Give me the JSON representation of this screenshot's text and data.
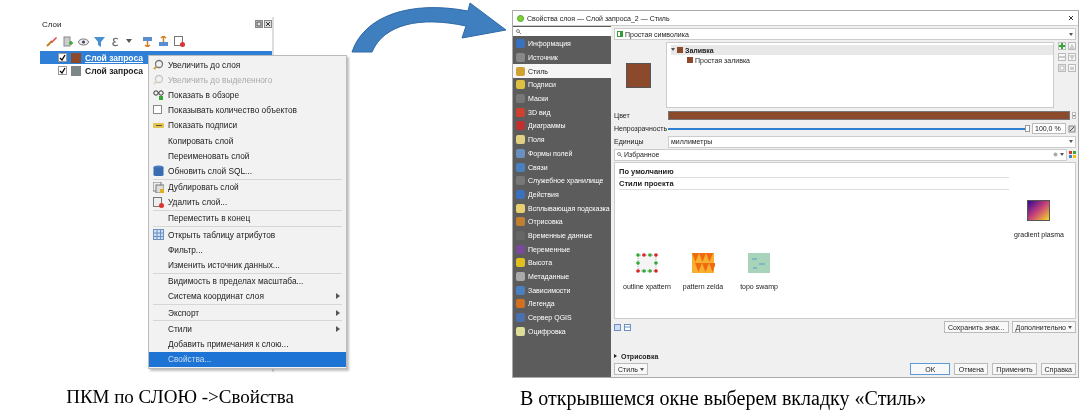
{
  "left": {
    "panel_title": "Слои",
    "layers": [
      {
        "name": "Слой запроса",
        "checked": true,
        "color": "#8b4a2b",
        "selected": true
      },
      {
        "name": "Слой запроса",
        "checked": true,
        "color": "#7d8787",
        "selected": false
      }
    ],
    "context_menu": [
      [
        {
          "label": "Увеличить до слоя",
          "kind": "zoom",
          "disabled": false,
          "selected": false,
          "submenu": false
        },
        {
          "label": "Увеличить до выделенного",
          "kind": "zoom",
          "disabled": true,
          "selected": false,
          "submenu": false
        },
        {
          "label": "Показать в обзоре",
          "kind": "overview",
          "disabled": false,
          "selected": false,
          "submenu": false
        },
        {
          "label": "Показывать количество объектов",
          "kind": "checkbox",
          "checked": false,
          "disabled": false,
          "selected": false,
          "submenu": false
        },
        {
          "label": "Показать подписи",
          "kind": "labels",
          "disabled": false,
          "selected": false,
          "submenu": false
        },
        {
          "label": "Копировать слой",
          "kind": "plain",
          "disabled": false,
          "selected": false,
          "submenu": false
        },
        {
          "label": "Переименовать слой",
          "kind": "plain",
          "disabled": false,
          "selected": false,
          "submenu": false
        },
        {
          "label": "Обновить слой SQL...",
          "kind": "database",
          "disabled": false,
          "selected": false,
          "submenu": false
        }
      ],
      [
        {
          "label": "Дублировать слой",
          "kind": "duplicate",
          "disabled": false,
          "selected": false,
          "submenu": false
        },
        {
          "label": "Удалить слой...",
          "kind": "remove",
          "disabled": false,
          "selected": false,
          "submenu": false
        }
      ],
      [
        {
          "label": "Переместить в конец",
          "kind": "plain",
          "disabled": false,
          "selected": false,
          "submenu": false
        }
      ],
      [
        {
          "label": "Открыть таблицу атрибутов",
          "kind": "table",
          "disabled": false,
          "selected": false,
          "submenu": false
        },
        {
          "label": "Фильтр...",
          "kind": "plain",
          "disabled": false,
          "selected": false,
          "submenu": false
        },
        {
          "label": "Изменить источник данных...",
          "kind": "plain",
          "disabled": false,
          "selected": false,
          "submenu": false
        }
      ],
      [
        {
          "label": "Видимость в пределах масштаба...",
          "kind": "plain",
          "disabled": false,
          "selected": false,
          "submenu": false
        },
        {
          "label": "Система координат слоя",
          "kind": "plain",
          "disabled": false,
          "selected": false,
          "submenu": true
        }
      ],
      [
        {
          "label": "Экспорт",
          "kind": "plain",
          "disabled": false,
          "selected": false,
          "submenu": true
        }
      ],
      [
        {
          "label": "Стили",
          "kind": "plain",
          "disabled": false,
          "selected": false,
          "submenu": true
        },
        {
          "label": "Добавить примечания к слою...",
          "kind": "plain",
          "disabled": false,
          "selected": false,
          "submenu": false
        },
        {
          "label": "Свойства...",
          "kind": "plain",
          "disabled": false,
          "selected": true,
          "submenu": false
        }
      ]
    ],
    "caption": "ПКМ по СЛОЮ ->Свойства"
  },
  "dialog": {
    "title": "Свойства слоя — Слой запроса_2 — Стиль",
    "sidebar": [
      {
        "label": "Информация",
        "selected": false
      },
      {
        "label": "Источник",
        "selected": false
      },
      {
        "label": "Стиль",
        "selected": true
      },
      {
        "label": "Подписи",
        "selected": false
      },
      {
        "label": "Маски",
        "selected": false
      },
      {
        "label": "3D вид",
        "selected": false
      },
      {
        "label": "Диаграммы",
        "selected": false
      },
      {
        "label": "Поля",
        "selected": false
      },
      {
        "label": "Формы полей",
        "selected": false
      },
      {
        "label": "Связи",
        "selected": false
      },
      {
        "label": "Служебное хранилище",
        "selected": false
      },
      {
        "label": "Действия",
        "selected": false
      },
      {
        "label": "Всплывающая подсказка",
        "selected": false
      },
      {
        "label": "Отрисовка",
        "selected": false
      },
      {
        "label": "Временные данные",
        "selected": false
      },
      {
        "label": "Переменные",
        "selected": false
      },
      {
        "label": "Высота",
        "selected": false
      },
      {
        "label": "Метаданные",
        "selected": false
      },
      {
        "label": "Зависимости",
        "selected": false
      },
      {
        "label": "Легенда",
        "selected": false
      },
      {
        "label": "Сервер QGIS",
        "selected": false
      },
      {
        "label": "Оцифровка",
        "selected": false
      }
    ],
    "renderer": "Простая символика",
    "symbol_tree": {
      "label": "Заливка",
      "color": "#8b4a2b",
      "expanded": true,
      "children": [
        {
          "label": "Простая заливка"
        }
      ]
    },
    "color_label": "Цвет",
    "opacity_label": "Непрозрачность",
    "opacity": {
      "level": 1.0,
      "reading": "100,0 %"
    },
    "units_label": "Единицы",
    "units": "миллиметры",
    "search_value": "Избранное",
    "groups": [
      "По умолчанию",
      "Стили проекта"
    ],
    "symbols": [
      {
        "name": "gradient  plasma",
        "kind": "gradient"
      },
      {
        "name": "outline xpattern",
        "kind": "dots"
      },
      {
        "name": "pattern zelda",
        "kind": "triangles"
      },
      {
        "name": "topo swamp",
        "kind": "swamp"
      }
    ],
    "save_button": "Сохранить знак...",
    "advanced_button": "Дополнительно",
    "rendering_section": {
      "label": "Отрисовка",
      "expanded": false
    },
    "style_button": "Стиль",
    "buttons": [
      "OK",
      "Отмена",
      "Применить",
      "Справка"
    ]
  },
  "caption": "В открывшемся окне выберем вкладку «Стиль»"
}
